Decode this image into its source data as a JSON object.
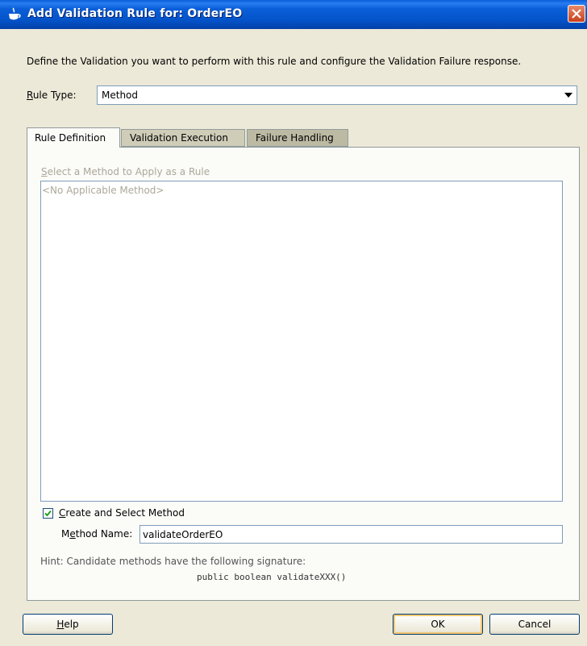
{
  "window": {
    "title": "Add Validation Rule for: OrderEO",
    "icon": "coffee-cup-icon",
    "close_icon": "close-icon"
  },
  "description": "Define the Validation you want to perform with this rule and configure the Validation Failure response.",
  "rule_type": {
    "label_mnemonic": "R",
    "label_rest": "ule Type:",
    "value": "Method"
  },
  "tabs": [
    {
      "label": "Rule Definition",
      "active": true
    },
    {
      "label": "Validation Execution",
      "active": false
    },
    {
      "label": "Failure Handling",
      "active": false
    }
  ],
  "rule_definition": {
    "select_label_mnemonic": "S",
    "select_label_rest": "elect a Method to Apply as a Rule",
    "list_items": [
      "<No Applicable Method>"
    ],
    "create_checkbox": {
      "checked": true,
      "label_mnemonic": "C",
      "label_rest": "reate and Select Method"
    },
    "method_name": {
      "label_pre": "M",
      "label_mnemonic": "e",
      "label_rest": "thod Name:",
      "value": "validateOrderEO"
    },
    "hint": "Hint: Candidate methods have the following signature:",
    "signature": "public boolean validateXXX()"
  },
  "buttons": {
    "help_mnemonic": "H",
    "help_rest": "elp",
    "ok": "OK",
    "cancel": "Cancel"
  },
  "colors": {
    "titlebar": "#0a5fd8",
    "dialog_bg": "#ece9d8",
    "panel_bg": "#fbfbf8",
    "close_button": "#c8401c"
  }
}
